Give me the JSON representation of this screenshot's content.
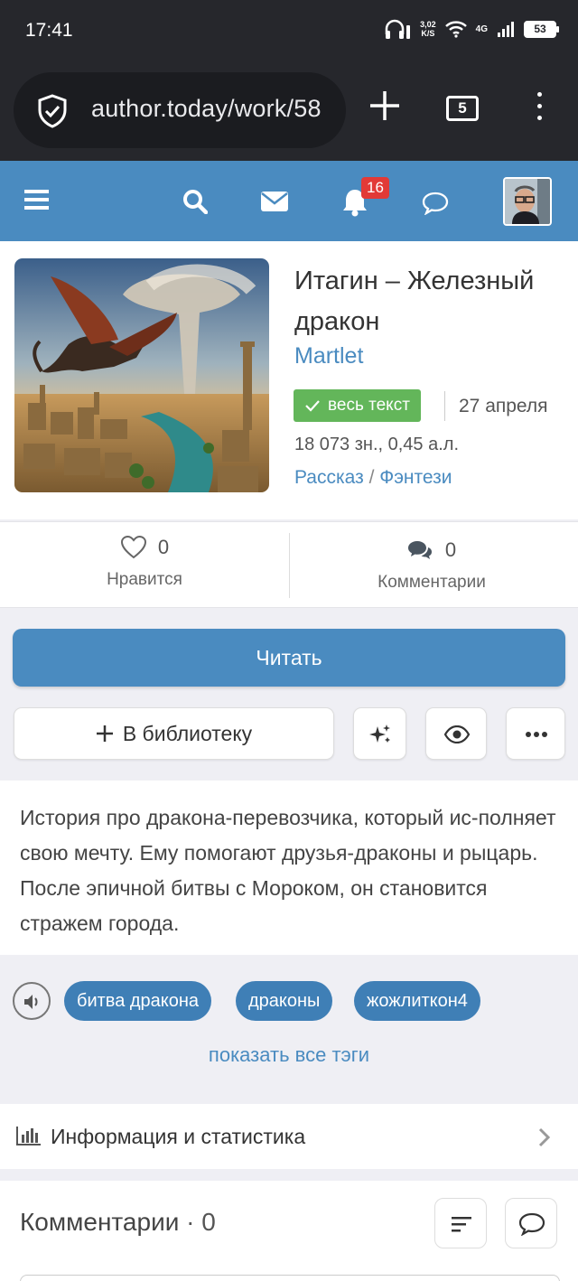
{
  "status_bar": {
    "time": "17:41",
    "speed_value": "3,02",
    "speed_unit": "K/S",
    "network": "4G",
    "battery": "53"
  },
  "browser": {
    "url": "author.today/work/58",
    "tab_count": "5"
  },
  "site_header": {
    "notification_count": "16"
  },
  "book": {
    "title": "Итагин – Железный дракон",
    "author": "Martlet",
    "status": "весь текст",
    "date": "27 апреля",
    "size": "18 073 зн., 0,45 а.л.",
    "form": "Рассказ",
    "genre_separator": "/",
    "genre": "Фэнтези"
  },
  "stats": {
    "likes_count": "0",
    "likes_label": "Нравится",
    "comments_count": "0",
    "comments_label": "Комментарии"
  },
  "actions": {
    "read_label": "Читать",
    "library_label": "В библиотеку"
  },
  "description": "История про дракона-перевозчика, который ис-полняет свою мечту. Ему помогают друзья-драконы и рыцарь. После эпичной битвы с Мороком, он становится стражем города.",
  "tags": [
    "битва дракона",
    "драконы",
    "жожлиткон4"
  ],
  "show_all_tags": "показать все тэги",
  "info_label": "Информация и статистика",
  "comments_section": {
    "title": "Комментарии",
    "separator": "·",
    "count": "0"
  },
  "colors": {
    "accent": "#4a8bc0",
    "status_green": "#63b65a",
    "badge_red": "#e23a37",
    "dark_bar": "#26272c"
  },
  "icons": [
    "shield-icon",
    "plus-icon",
    "tabs-icon",
    "more-vert-icon",
    "hamburger-icon",
    "search-icon",
    "mail-icon",
    "bell-icon",
    "chat-icon",
    "heart-icon",
    "comments-icon",
    "sparkle-icon",
    "eye-icon",
    "more-horiz-icon",
    "speaker-icon",
    "chart-icon",
    "chevron-right-icon",
    "sort-icon",
    "comment-bubble-icon",
    "check-icon"
  ]
}
